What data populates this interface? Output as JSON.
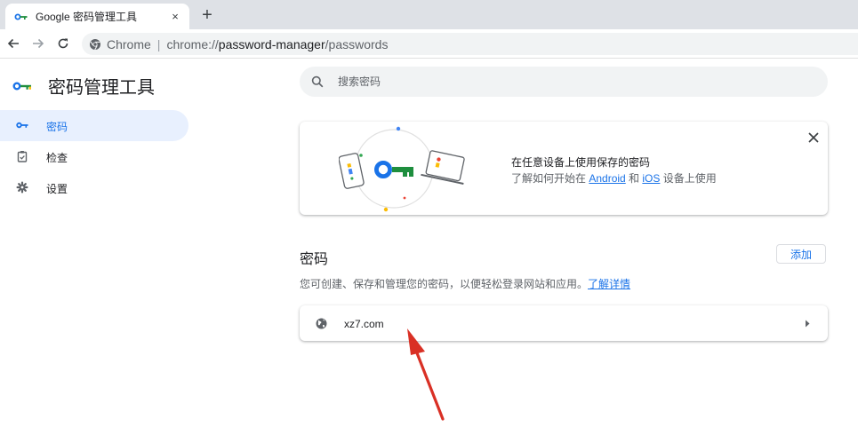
{
  "browser": {
    "tab_title": "Google 密码管理工具",
    "tab_close": "×",
    "new_tab": "+",
    "omnibox_label": "Chrome",
    "omnibox_separator": "|",
    "url_scheme": "chrome://",
    "url_host": "password-manager",
    "url_path": "/passwords"
  },
  "app": {
    "title": "密码管理工具"
  },
  "sidebar": {
    "items": [
      {
        "label": "密码",
        "icon": "key-icon",
        "active": true
      },
      {
        "label": "检查",
        "icon": "checkup-icon",
        "active": false
      },
      {
        "label": "设置",
        "icon": "gear-icon",
        "active": false
      }
    ]
  },
  "search": {
    "placeholder": "搜索密码"
  },
  "promo": {
    "title": "在任意设备上使用保存的密码",
    "sub_prefix": "了解如何开始在 ",
    "link_android": "Android",
    "sub_middle": " 和 ",
    "link_ios": "iOS",
    "sub_suffix": " 设备上使用"
  },
  "passwords": {
    "heading": "密码",
    "add_label": "添加",
    "description": "您可创建、保存和管理您的密码，以便轻松登录网站和应用。",
    "learn_more": "了解详情",
    "sites": [
      {
        "name": "xz7.com"
      }
    ]
  },
  "colors": {
    "accent": "#1a73e8",
    "key_green": "#1e8e3e",
    "annotation_arrow": "#d93025"
  }
}
